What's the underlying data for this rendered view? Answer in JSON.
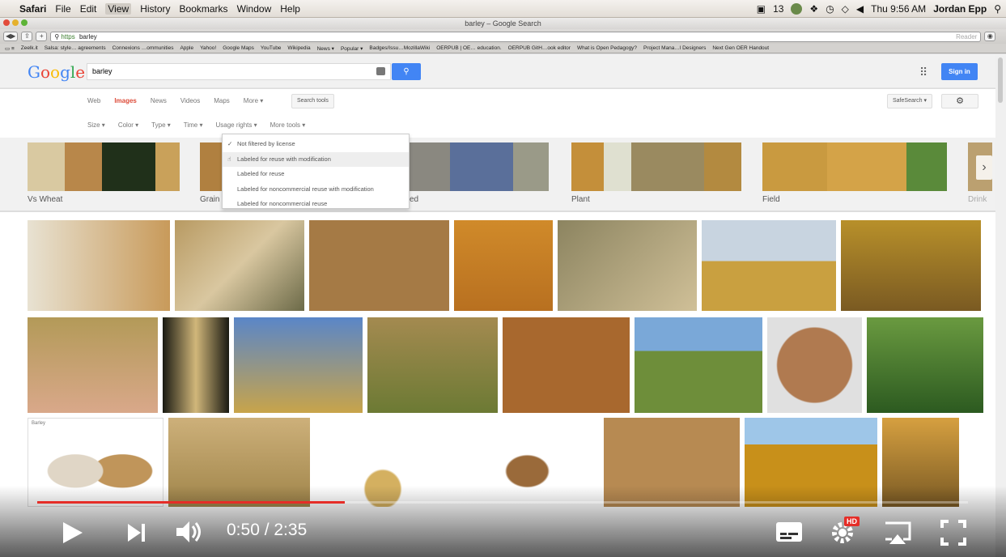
{
  "menubar": {
    "app": "Safari",
    "items": [
      "File",
      "Edit",
      "View",
      "History",
      "Bookmarks",
      "Window",
      "Help"
    ],
    "status_badge": "13",
    "clock": "Thu 9:56 AM",
    "user": "Jordan Epp"
  },
  "window": {
    "title": "barley – Google Search"
  },
  "toolbar": {
    "url_scheme": "https",
    "url_text": "barley",
    "reader": "Reader"
  },
  "bookmarks": [
    "Zeelk.it",
    "Salsa: style… agreements",
    "Connexions …ommunities",
    "Apple",
    "Yahoo!",
    "Google Maps",
    "YouTube",
    "Wikipedia",
    "News ▾",
    "Popular ▾",
    "Badges/Issu…MozillaWiki",
    "OERPUB | OE… education.",
    "OERPUB GitH…ook editor",
    "What is Open Pedagogy?",
    "Project Mana…l Designers",
    "Next Gen OER Handout"
  ],
  "google": {
    "logo": "Google",
    "query": "barley",
    "signin": "Sign in",
    "tabs": [
      "Web",
      "Images",
      "News",
      "Videos",
      "Maps",
      "More ▾"
    ],
    "search_tools": "Search tools",
    "safesearch": "SafeSearch ▾",
    "filters": [
      "Size ▾",
      "Color ▾",
      "Type ▾",
      "Time ▾",
      "Usage rights ▾",
      "More tools ▾"
    ],
    "related": [
      {
        "label": "Vs Wheat",
        "colors": [
          "#d9c9a1",
          "#b8874a",
          "#20301a",
          "#c9a15a"
        ]
      },
      {
        "label": "Grain",
        "colors": [
          "#b08040"
        ]
      },
      {
        "label": "ed",
        "colors": [
          "#8a8880",
          "#5a6f9a",
          "#9a9a88"
        ]
      },
      {
        "label": "Plant",
        "colors": [
          "#c48f3a",
          "#dfe0d0",
          "#9a8a60",
          "#b38a40"
        ]
      },
      {
        "label": "Field",
        "colors": [
          "#c99a40",
          "#d4a348",
          "#5a8a3a"
        ]
      },
      {
        "label": "Drink",
        "colors": [
          "#bba070"
        ]
      }
    ],
    "usage_rights_options": [
      "Not filtered by license",
      "Labeled for reuse with modification",
      "Labeled for reuse",
      "Labeled for noncommercial reuse with modification",
      "Labeled for noncommercial reuse"
    ],
    "card_label": "Barley"
  },
  "video": {
    "time": "0:50 / 2:35",
    "progress": 0.33,
    "hd": "HD"
  },
  "colors": {
    "progress": "#e52d27",
    "google_blue": "#4285f4",
    "active_tab": "#dd4b39"
  }
}
